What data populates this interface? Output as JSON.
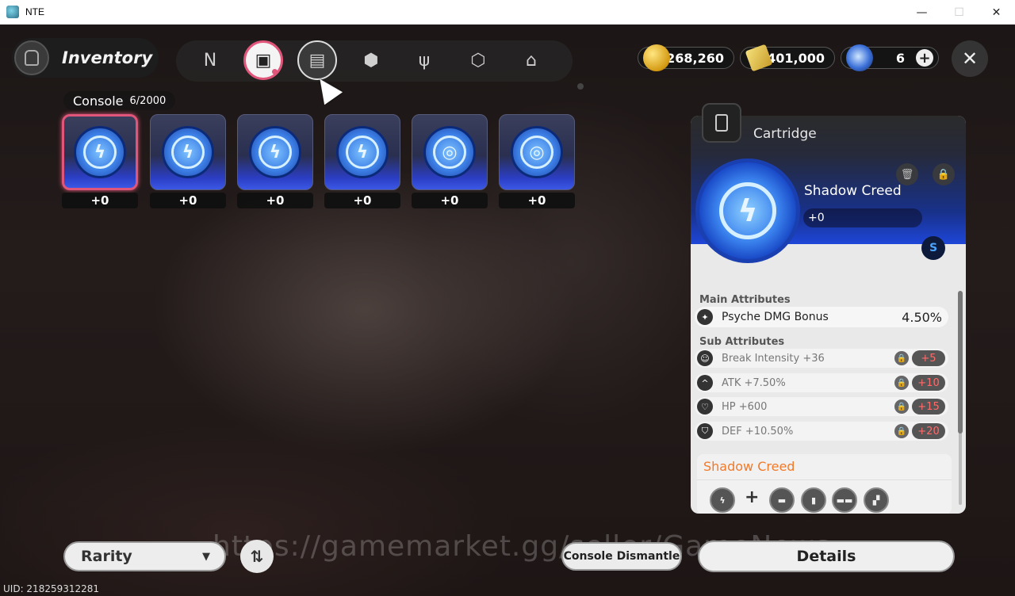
{
  "window": {
    "title": "NTE",
    "controls": [
      "—",
      "☐",
      "✕"
    ]
  },
  "header": {
    "title": "Inventory",
    "tabs": [
      {
        "icon": "n-logo-icon",
        "glyph": "N"
      },
      {
        "icon": "handheld-console-icon",
        "glyph": "▣"
      },
      {
        "icon": "cartridge-icon",
        "glyph": "▤"
      },
      {
        "icon": "box-icon",
        "glyph": "⬢"
      },
      {
        "icon": "fork-knife-icon",
        "glyph": "ψ"
      },
      {
        "icon": "cube-outline-icon",
        "glyph": "⬡"
      },
      {
        "icon": "home-icon",
        "glyph": "⌂"
      }
    ],
    "currencies": [
      {
        "icon": "gold-coin-icon",
        "value": "268,260"
      },
      {
        "icon": "ticket-icon",
        "value": "401,000"
      },
      {
        "icon": "crystal-orb-icon",
        "value": "6"
      }
    ],
    "close_glyph": "✕",
    "plus_glyph": "+"
  },
  "grid": {
    "label": "Console",
    "count": "6/2000",
    "items": [
      {
        "level": "+0",
        "glyph": "ϟ"
      },
      {
        "level": "+0",
        "glyph": "ϟ"
      },
      {
        "level": "+0",
        "glyph": "ϟ"
      },
      {
        "level": "+0",
        "glyph": "ϟ"
      },
      {
        "level": "+0",
        "glyph": "◎"
      },
      {
        "level": "+0",
        "glyph": "◎"
      }
    ]
  },
  "detail": {
    "category": "Cartridge",
    "name": "Shadow Creed",
    "level": "+0",
    "disc_glyph": "ϟ",
    "set_badge": "S",
    "main_attributes_title": "Main Attributes",
    "main_attribute": {
      "name": "Psyche DMG Bonus",
      "value": "4.50%"
    },
    "sub_attributes_title": "Sub Attributes",
    "sub_attributes": [
      {
        "name": "Break Intensity +36",
        "upgrade": "+5",
        "icon": "smile-icon"
      },
      {
        "name": "ATK +7.50%",
        "upgrade": "+10",
        "icon": "mountain-icon"
      },
      {
        "name": "HP +600",
        "upgrade": "+15",
        "icon": "heart-icon"
      },
      {
        "name": "DEF +10.50%",
        "upgrade": "+20",
        "icon": "shield-icon"
      }
    ],
    "set_name": "Shadow Creed",
    "set_slots": [
      "ϟ",
      "▬",
      "▮",
      "▬▬",
      "▞"
    ],
    "set_plus": "+"
  },
  "bottom": {
    "sort_label": "Rarity",
    "sort_caret": "▼",
    "order_glyph": "⇅",
    "dismantle_label": "Console Dismantle",
    "details_label": "Details",
    "uid": "UID: 218259312281",
    "watermark": "https://gamemarket.gg/seller/GameNews"
  }
}
